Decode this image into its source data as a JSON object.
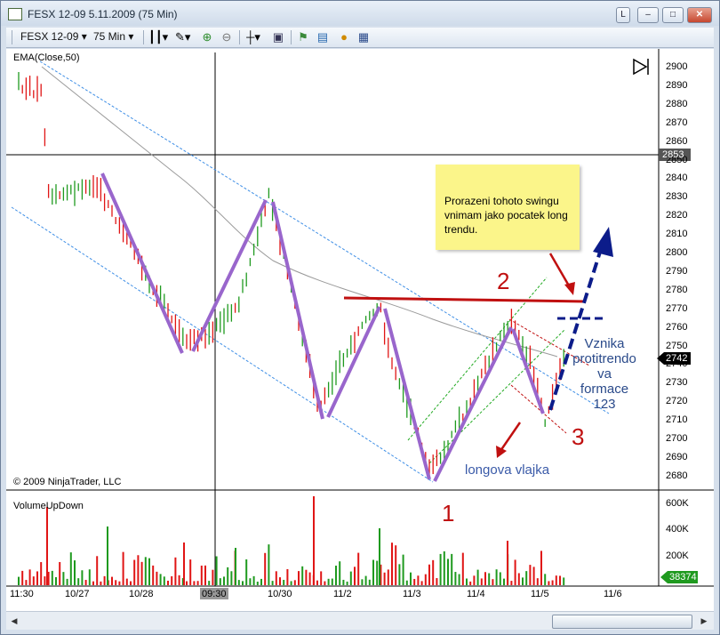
{
  "window": {
    "title": "FESX 12-09   5.11.2009 (75 Min)",
    "buttons": {
      "restore_small": "L",
      "minimize": "–",
      "maximize": "□",
      "close": "✕"
    }
  },
  "toolbar": {
    "instrument": "FESX 12-09",
    "period": "75 Min",
    "icons": [
      "bar-type-icon",
      "draw-tool-icon",
      "zoom-in-icon",
      "zoom-out-icon",
      "crosshair-icon",
      "data-box-icon",
      "indicators-icon",
      "strategies-icon",
      "order-icon",
      "properties-icon"
    ]
  },
  "chart": {
    "indicator_label": "EMA(Close,50)",
    "copyright": "© 2009 NinjaTrader, LLC",
    "volume_label": "VolumeUpDown",
    "price_axis": [
      "2900",
      "2890",
      "2880",
      "2870",
      "2860",
      "2850",
      "2840",
      "2830",
      "2820",
      "2810",
      "2800",
      "2790",
      "2780",
      "2770",
      "2760",
      "2750",
      "2740",
      "2730",
      "2720",
      "2710",
      "2700",
      "2690",
      "2680"
    ],
    "crosshair_price": "2853",
    "last_price": "2742",
    "volume_axis": [
      "600K",
      "400K",
      "200K"
    ],
    "last_volume": "38374",
    "time_axis": [
      "11:30",
      "10/27",
      "10/28",
      "09:30",
      "10/30",
      "11/2",
      "11/3",
      "11/4",
      "11/5",
      "11/6"
    ],
    "colors": {
      "up": "#1f9a1f",
      "down": "#e01515",
      "swing": "#9966cc",
      "channel": "#3f8fe6",
      "annotation": "#c01010",
      "arrow": "#0c1c8a"
    }
  },
  "annotations": {
    "note": "Prorazeni tohoto swingu vnimam jako pocatek long trendu.",
    "num_1": "1",
    "num_2": "2",
    "num_3": "3",
    "flag_label": "longova vlajka",
    "pattern_line1": "Vznika",
    "pattern_line2": "protitrendo",
    "pattern_line3": "va formace",
    "pattern_line4": "123"
  }
}
